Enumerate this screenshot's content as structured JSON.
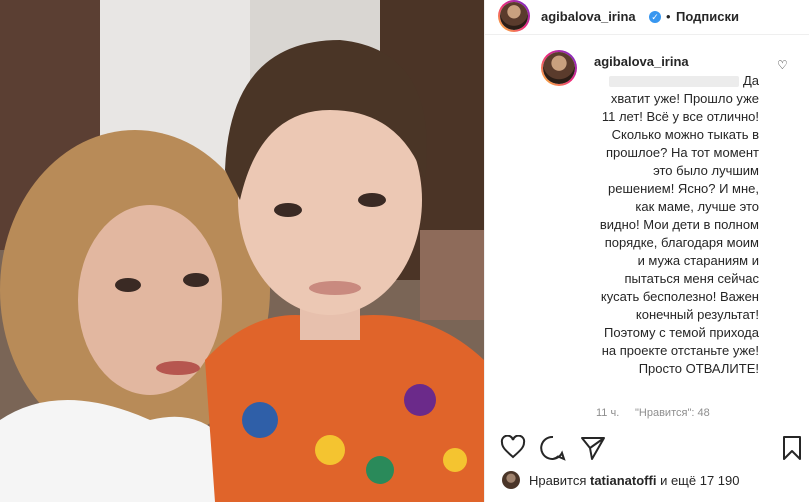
{
  "post": {
    "username": "agibalova_irina",
    "follow_label": "Подписки",
    "separator": "•"
  },
  "comment": {
    "username": "agibalova_irina",
    "text": "Да хватит уже! Прошло уже 11 лет! Всё у все отлично! Сколько можно тыкать в прошлое? На тот момент это было лучшим решением! Ясно? И мне, как маме, лучше это видно! Мои дети в полном порядке, благодаря моим и мужа стараниям и пытаться меня сейчас кусать бесполезно! Важен конечный результат! Поэтому с темой прихода на проекте отстаньте уже! Просто ОТВАЛИТЕ!",
    "time": "11 ч.",
    "likes": "\"Нравится\": 48"
  },
  "likes": {
    "prefix": "Нравится",
    "user": "tatianatoffi",
    "suffix": "и ещё 17 190"
  },
  "icons": [
    "verified-badge",
    "heart-icon",
    "comment-icon",
    "share-icon",
    "bookmark-icon"
  ],
  "colors": {
    "verified": "#3897f0",
    "meta": "#8e8e8e",
    "border": "#efefef"
  }
}
